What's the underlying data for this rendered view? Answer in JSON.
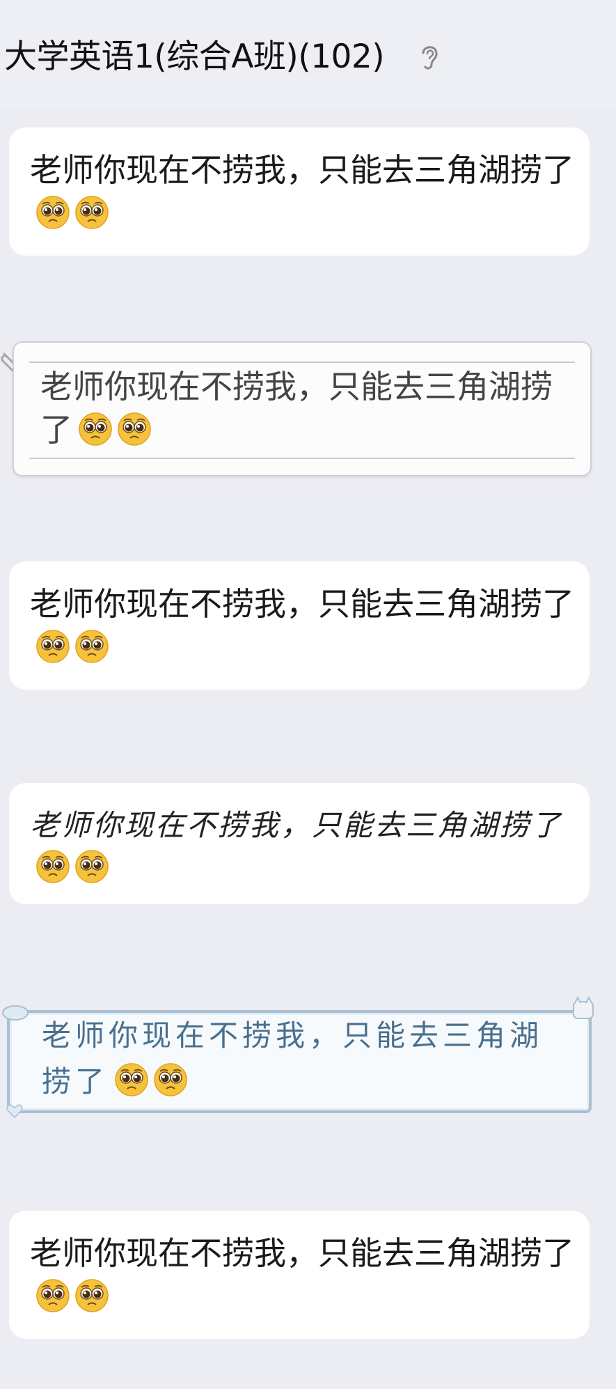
{
  "header": {
    "title": "大学英语1(综合A班)(102)",
    "ear_icon": "ear-icon"
  },
  "messages": [
    {
      "text": "老师你现在不捞我，只能去三角湖捞了",
      "emoji": [
        "pleading-face",
        "pleading-face"
      ],
      "style": "plain"
    },
    {
      "text": "老师你现在不捞我，只能去三角湖捞了",
      "emoji": [
        "pleading-face",
        "pleading-face"
      ],
      "style": "paper"
    },
    {
      "text": "老师你现在不捞我，只能去三角湖捞了",
      "emoji": [
        "pleading-face",
        "pleading-face"
      ],
      "style": "plain"
    },
    {
      "text": "老师你现在不捞我，只能去三角湖捞了",
      "emoji": [
        "pleading-face",
        "pleading-face"
      ],
      "style": "handwriting"
    },
    {
      "text": "老师你现在不捞我，只能去三角湖捞了",
      "emoji": [
        "pleading-face",
        "pleading-face"
      ],
      "style": "blue-frame"
    },
    {
      "text": "老师你现在不捞我，只能去三角湖捞了",
      "emoji": [
        "pleading-face",
        "pleading-face"
      ],
      "style": "plain"
    }
  ],
  "colors": {
    "background": "#ececf3",
    "bubble": "#ffffff",
    "frame_border": "#a9bfd1",
    "frame_text": "#48708f"
  }
}
